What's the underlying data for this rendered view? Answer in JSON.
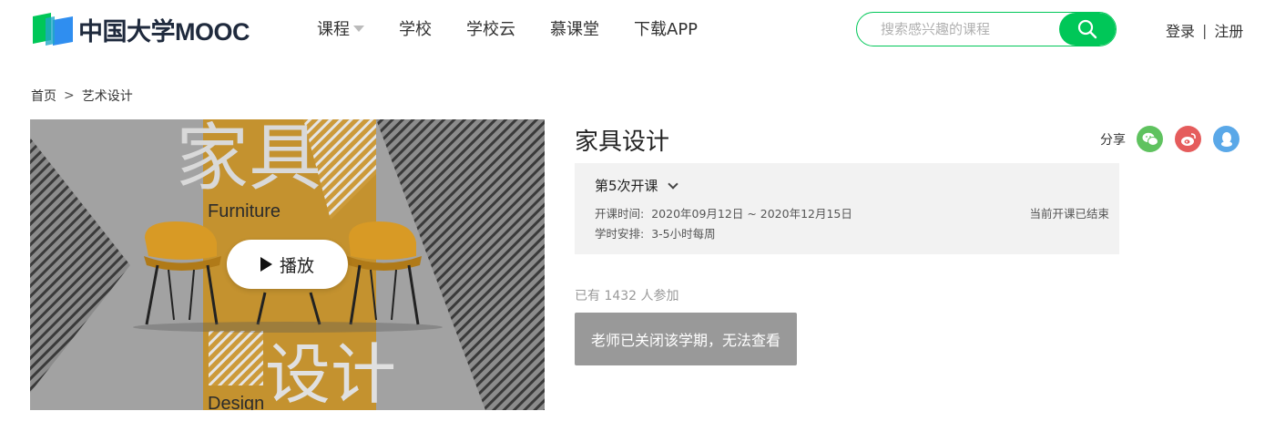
{
  "brand": {
    "logo_text": "中国大学MOOC",
    "primary_color": "#00c758"
  },
  "nav": [
    {
      "label": "课程",
      "has_dropdown": true
    },
    {
      "label": "学校"
    },
    {
      "label": "学校云"
    },
    {
      "label": "慕课堂"
    },
    {
      "label": "下载APP"
    }
  ],
  "search": {
    "placeholder": "搜索感兴趣的课程",
    "value": "",
    "icon": "search-icon"
  },
  "auth": {
    "login": "登录",
    "separator": "|",
    "register": "注册"
  },
  "breadcrumb": {
    "home": "首页",
    "arrow": ">",
    "category": "艺术设计"
  },
  "cover": {
    "play_label": "播放",
    "art_text": {
      "title_cn_1": "家具",
      "title_cn_2": "设计",
      "en_1": "Furniture",
      "en_2": "Design"
    }
  },
  "course": {
    "title": "家具设计",
    "share_label": "分享",
    "share_icons": [
      "wechat-icon",
      "weibo-icon",
      "qq-icon"
    ],
    "term": {
      "selected": "第5次开课",
      "time_label": "开课时间:",
      "time_value": "2020年09月12日 ~ 2020年12月15日",
      "hours_label": "学时安排:",
      "hours_value": "3-5小时每周",
      "status": "当前开课已结束"
    },
    "enrolled_text": "已有 1432 人参加",
    "closed_button": "老师已关闭该学期，无法查看"
  }
}
